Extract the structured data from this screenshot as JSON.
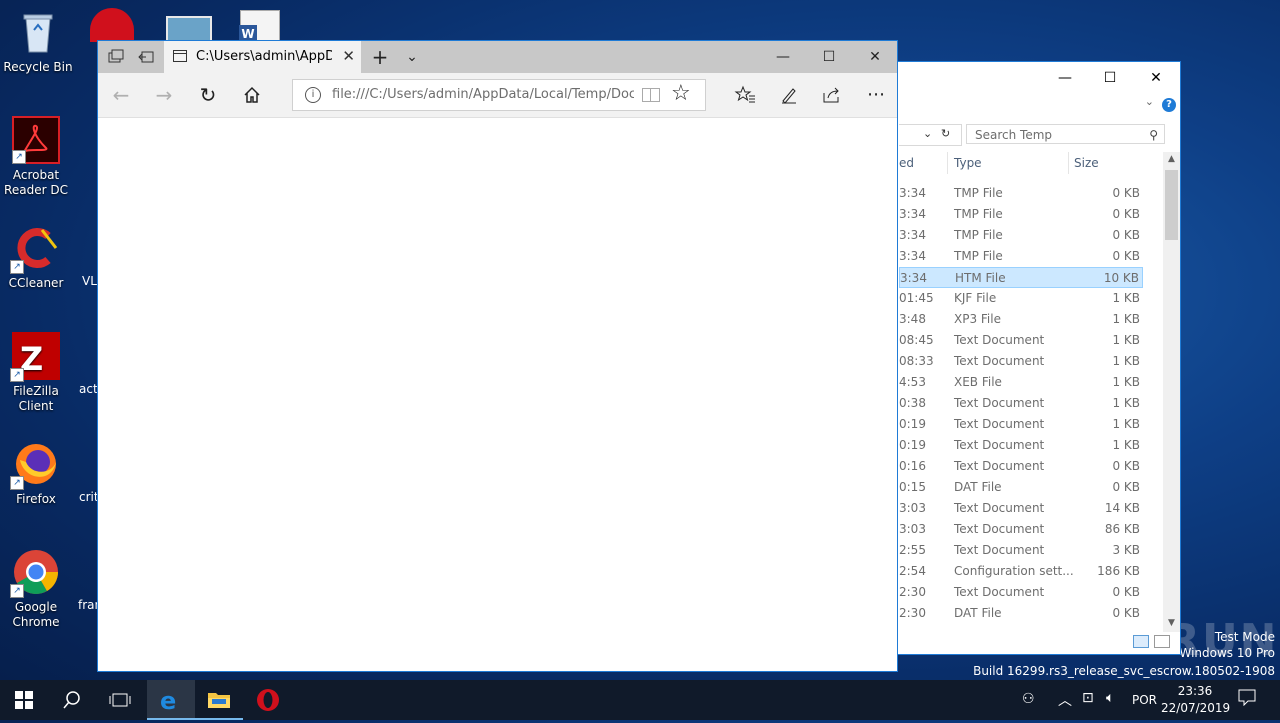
{
  "desktop": {
    "icons": [
      {
        "label": "Recycle Bin"
      },
      {
        "label": "Acrobat Reader DC"
      },
      {
        "label": "CCleaner"
      },
      {
        "label": "FileZilla Client"
      },
      {
        "label": "Firefox"
      },
      {
        "label": "Google Chrome"
      }
    ],
    "partial_labels": [
      "VL",
      "acti",
      "crit",
      "fran"
    ]
  },
  "edge": {
    "tab_title": "C:\\Users\\admin\\AppDat",
    "address": "file:///C:/Users/admin/AppData/Local/Temp/Docume",
    "controls": {
      "minimize": "—",
      "maximize": "☐",
      "close": "✕"
    }
  },
  "explorer": {
    "search_placeholder": "Search Temp",
    "columns": {
      "date": "ed",
      "type": "Type",
      "size": "Size"
    },
    "rows": [
      {
        "date": "3:34",
        "type": "TMP File",
        "size": "0 KB"
      },
      {
        "date": "3:34",
        "type": "TMP File",
        "size": "0 KB"
      },
      {
        "date": "3:34",
        "type": "TMP File",
        "size": "0 KB"
      },
      {
        "date": "3:34",
        "type": "TMP File",
        "size": "0 KB"
      },
      {
        "date": "3:34",
        "type": "HTM File",
        "size": "10 KB",
        "selected": true
      },
      {
        "date": "01:45",
        "type": "KJF File",
        "size": "1 KB"
      },
      {
        "date": "3:48",
        "type": "XP3 File",
        "size": "1 KB"
      },
      {
        "date": "08:45",
        "type": "Text Document",
        "size": "1 KB"
      },
      {
        "date": "08:33",
        "type": "Text Document",
        "size": "1 KB"
      },
      {
        "date": "4:53",
        "type": "XEB File",
        "size": "1 KB"
      },
      {
        "date": "0:38",
        "type": "Text Document",
        "size": "1 KB"
      },
      {
        "date": "0:19",
        "type": "Text Document",
        "size": "1 KB"
      },
      {
        "date": "0:19",
        "type": "Text Document",
        "size": "1 KB"
      },
      {
        "date": "0:16",
        "type": "Text Document",
        "size": "0 KB"
      },
      {
        "date": "0:15",
        "type": "DAT File",
        "size": "0 KB"
      },
      {
        "date": "3:03",
        "type": "Text Document",
        "size": "14 KB"
      },
      {
        "date": "3:03",
        "type": "Text Document",
        "size": "86 KB"
      },
      {
        "date": "2:55",
        "type": "Text Document",
        "size": "3 KB"
      },
      {
        "date": "2:54",
        "type": "Configuration sett...",
        "size": "186 KB"
      },
      {
        "date": "2:30",
        "type": "Text Document",
        "size": "0 KB"
      },
      {
        "date": "2:30",
        "type": "DAT File",
        "size": "0 KB"
      }
    ]
  },
  "watermark": {
    "text": "ANY RUN",
    "mode": "Test Mode",
    "edition": "Windows 10 Pro",
    "build": "Build 16299.rs3_release_svc_escrow.180502-1908"
  },
  "taskbar": {
    "language": "POR",
    "time": "23:36",
    "date": "22/07/2019"
  },
  "colors": {
    "accent": "#1f7bd6",
    "selection": "#cce8ff",
    "taskbar": "#101a2a"
  }
}
